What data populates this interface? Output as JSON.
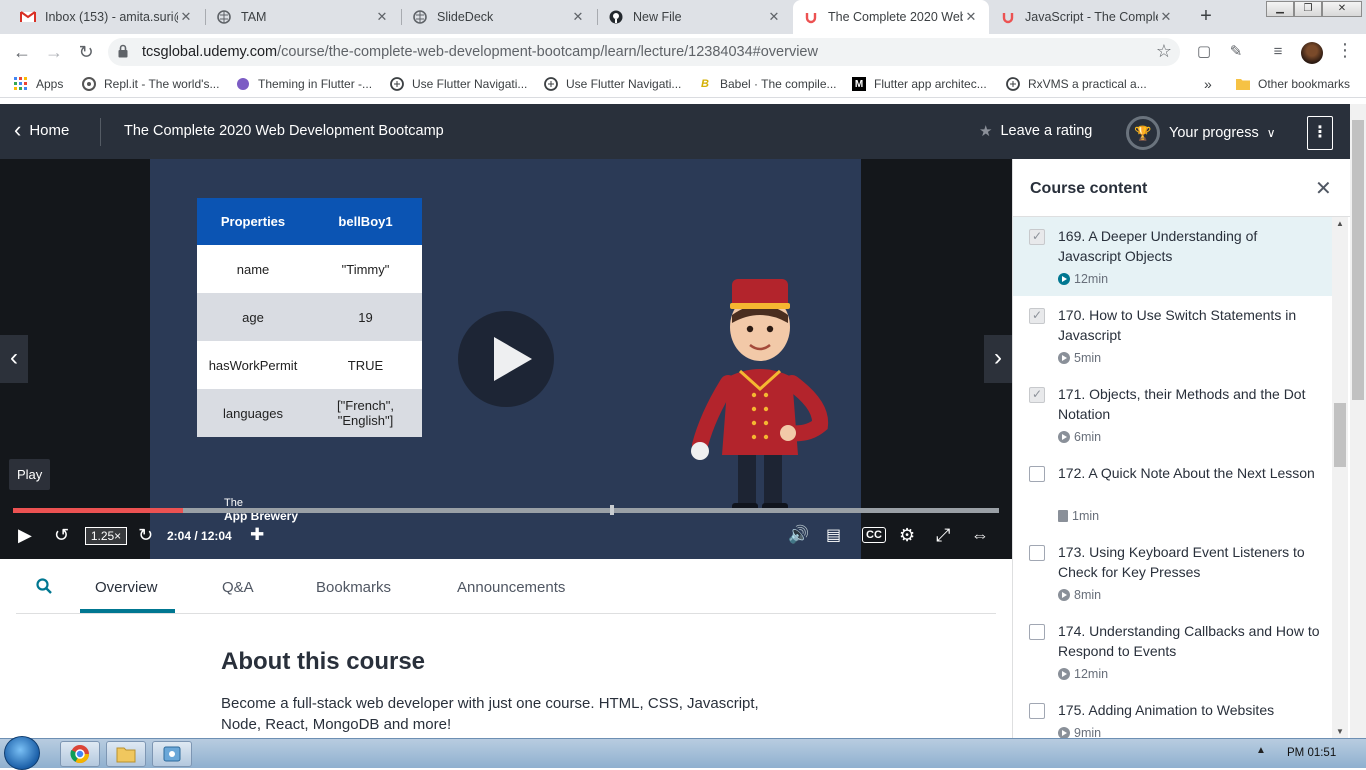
{
  "browser": {
    "tabs": [
      {
        "title": "Inbox (153) - amita.suri@",
        "icon": "gmail-icon"
      },
      {
        "title": "TAM",
        "icon": "globe-icon"
      },
      {
        "title": "SlideDeck",
        "icon": "globe-icon"
      },
      {
        "title": "New File",
        "icon": "github-icon"
      },
      {
        "title": "The Complete 2020 Web",
        "icon": "udemy-icon"
      },
      {
        "title": "JavaScript - The Complet",
        "icon": "udemy-icon"
      }
    ],
    "active_tab_index": 4,
    "url_host": "tcsglobal.udemy.com",
    "url_path": "/course/the-complete-web-development-bootcamp/learn/lecture/12384034#overview",
    "bookmarks": [
      {
        "label": "Apps",
        "icon": "apps-grid-icon"
      },
      {
        "label": "Repl.it - The world's...",
        "icon": "replit-icon"
      },
      {
        "label": "Theming in Flutter -...",
        "icon": "theming-icon"
      },
      {
        "label": "Use Flutter Navigati...",
        "icon": "globe-icon"
      },
      {
        "label": "Use Flutter Navigati...",
        "icon": "globe-icon"
      },
      {
        "label": "Babel · The compile...",
        "icon": "babel-icon"
      },
      {
        "label": "Flutter app architec...",
        "icon": "medium-icon"
      },
      {
        "label": "RxVMS a practical a...",
        "icon": "globe-icon"
      }
    ],
    "bookmarks_overflow": "»",
    "other_bookmarks": "Other bookmarks"
  },
  "header": {
    "home": "Home",
    "course_title": "The Complete 2020 Web Development Bootcamp",
    "leave_rating": "Leave a rating",
    "your_progress": "Your progress"
  },
  "video": {
    "table": {
      "headers": [
        "Properties",
        "bellBoy1"
      ],
      "rows": [
        [
          "name",
          "\"Timmy\""
        ],
        [
          "age",
          "19"
        ],
        [
          "hasWorkPermit",
          "TRUE"
        ],
        [
          "languages",
          "[\"French\", \"English\"]"
        ]
      ]
    },
    "tooltip": "Play",
    "speed": "1.25×",
    "time": "2:04 / 12:04",
    "progress_fraction": 0.172,
    "buffer_fraction": 0.605,
    "brand_line1": "The",
    "brand_line2": "App Brewery"
  },
  "lecture_tabs": [
    "Overview",
    "Q&A",
    "Bookmarks",
    "Announcements"
  ],
  "active_lecture_tab": "Overview",
  "about": {
    "title": "About this course",
    "description": "Become a full-stack web developer with just one course. HTML, CSS, Javascript, Node, React, MongoDB and more!"
  },
  "sidebar": {
    "title": "Course content",
    "lectures": [
      {
        "title": "169. A Deeper Understanding of Javascript Objects",
        "duration": "12min",
        "checked": true,
        "current": true,
        "kind": "video"
      },
      {
        "title": "170. How to Use Switch Statements in Javascript",
        "duration": "5min",
        "checked": true,
        "current": false,
        "kind": "video"
      },
      {
        "title": "171. Objects, their Methods and the Dot Notation",
        "duration": "6min",
        "checked": true,
        "current": false,
        "kind": "video"
      },
      {
        "title": "172. A Quick Note About the Next Lesson",
        "duration": "1min",
        "checked": false,
        "current": false,
        "kind": "doc"
      },
      {
        "title": "173. Using Keyboard Event Listeners to Check for Key Presses",
        "duration": "8min",
        "checked": false,
        "current": false,
        "kind": "video"
      },
      {
        "title": "174. Understanding Callbacks and How to Respond to Events",
        "duration": "12min",
        "checked": false,
        "current": false,
        "kind": "video"
      },
      {
        "title": "175. Adding Animation to Websites",
        "duration": "9min",
        "checked": false,
        "current": false,
        "kind": "video"
      }
    ]
  },
  "taskbar": {
    "clock": "PM 01:51"
  },
  "colors": {
    "udemy_header": "#29303b",
    "accent_teal": "#007791",
    "seek_red": "#ec5252",
    "table_header_blue": "#0b54b3"
  }
}
